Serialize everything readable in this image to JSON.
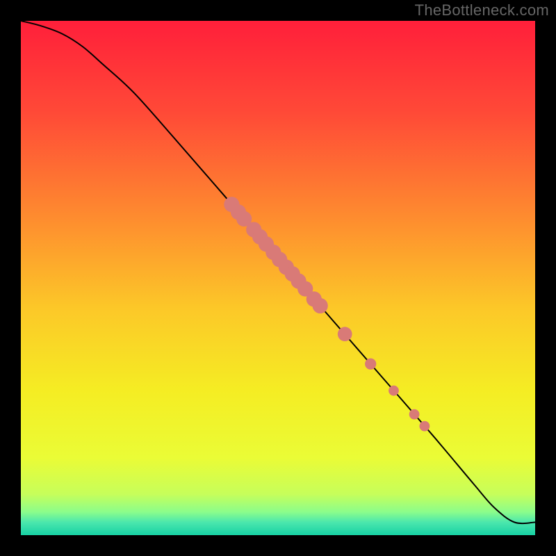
{
  "watermark": "TheBottleneck.com",
  "colors": {
    "point_fill": "#d97a77",
    "point_stroke": "#b5554f",
    "line": "#000000",
    "gradient_stops": [
      {
        "offset": 0.0,
        "color": "#ff1f3a"
      },
      {
        "offset": 0.18,
        "color": "#ff4a37"
      },
      {
        "offset": 0.38,
        "color": "#fe8b2f"
      },
      {
        "offset": 0.56,
        "color": "#fcc828"
      },
      {
        "offset": 0.72,
        "color": "#f5ed23"
      },
      {
        "offset": 0.85,
        "color": "#eafc36"
      },
      {
        "offset": 0.92,
        "color": "#c7fe5a"
      },
      {
        "offset": 0.955,
        "color": "#8bfd8b"
      },
      {
        "offset": 0.975,
        "color": "#4be7ad"
      },
      {
        "offset": 1.0,
        "color": "#17d1a4"
      }
    ]
  },
  "chart_data": {
    "type": "line",
    "title": "",
    "xlabel": "",
    "ylabel": "",
    "xlim": [
      0,
      100
    ],
    "ylim": [
      0,
      100
    ],
    "series": [
      {
        "name": "curve",
        "x": [
          0,
          4,
          8,
          12,
          16,
          22,
          30,
          40,
          50,
          60,
          70,
          80,
          88,
          92,
          96,
          100
        ],
        "y": [
          100,
          99,
          97.5,
          95,
          91.5,
          86,
          77,
          65.5,
          54,
          42.5,
          31,
          19.5,
          10,
          5.4,
          2.5,
          2.5
        ]
      }
    ],
    "points": [
      {
        "x": 41.0,
        "y": 64.3,
        "r": 1.5
      },
      {
        "x": 42.3,
        "y": 62.8,
        "r": 1.5
      },
      {
        "x": 43.4,
        "y": 61.5,
        "r": 1.5
      },
      {
        "x": 45.3,
        "y": 59.4,
        "r": 1.5
      },
      {
        "x": 46.5,
        "y": 58.0,
        "r": 1.5
      },
      {
        "x": 47.7,
        "y": 56.6,
        "r": 1.5
      },
      {
        "x": 49.1,
        "y": 55.0,
        "r": 1.5
      },
      {
        "x": 50.3,
        "y": 53.6,
        "r": 1.5
      },
      {
        "x": 51.6,
        "y": 52.1,
        "r": 1.5
      },
      {
        "x": 52.8,
        "y": 50.8,
        "r": 1.5
      },
      {
        "x": 54.0,
        "y": 49.4,
        "r": 1.5
      },
      {
        "x": 55.3,
        "y": 47.9,
        "r": 1.5
      },
      {
        "x": 57.0,
        "y": 45.9,
        "r": 1.5
      },
      {
        "x": 58.2,
        "y": 44.6,
        "r": 1.5
      },
      {
        "x": 63.0,
        "y": 39.1,
        "r": 1.4
      },
      {
        "x": 68.0,
        "y": 33.3,
        "r": 1.1
      },
      {
        "x": 72.5,
        "y": 28.1,
        "r": 1.0
      },
      {
        "x": 76.5,
        "y": 23.5,
        "r": 1.0
      },
      {
        "x": 78.5,
        "y": 21.2,
        "r": 1.0
      }
    ]
  }
}
